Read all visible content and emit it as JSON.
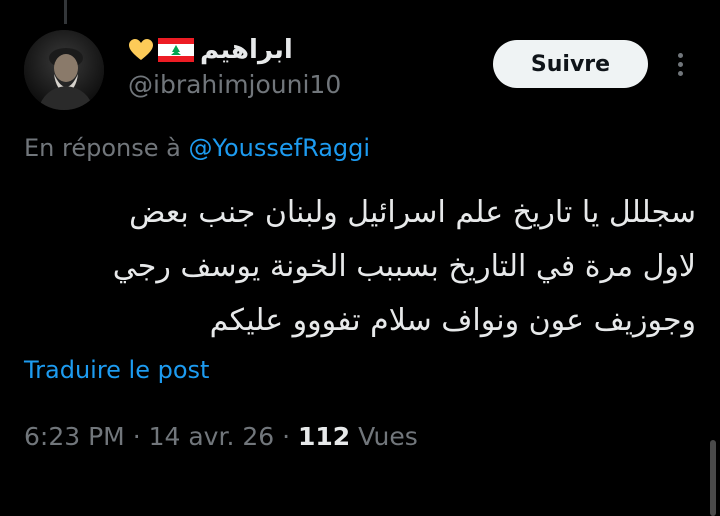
{
  "author": {
    "display_name": "ابراهيم",
    "emojis": [
      "yellow-heart-emoji",
      "lebanon-flag-emoji"
    ],
    "handle": "@ibrahimjouni10"
  },
  "actions": {
    "follow_label": "Suivre",
    "more_icon": "more-dots-icon"
  },
  "reply": {
    "prefix": "En réponse à",
    "mention": "@YoussefRaggi"
  },
  "tweet": {
    "lines": [
      "سجللل يا تاريخ علم اسرائيل ولبنان جنب بعض",
      "لاول مرة في التاريخ بسببب الخونة يوسف رجي",
      "وجوزيف عون ونواف سلام تفووو عليكم"
    ]
  },
  "translate_label": "Traduire le post",
  "meta": {
    "time": "6:23 PM",
    "separator": "·",
    "date": "14 avr. 26",
    "views_count": "112",
    "views_label": "Vues"
  },
  "colors": {
    "background": "#000000",
    "text": "#e7e9ea",
    "muted": "#71767b",
    "link": "#1d9bf0",
    "button_bg": "#eff3f4"
  }
}
